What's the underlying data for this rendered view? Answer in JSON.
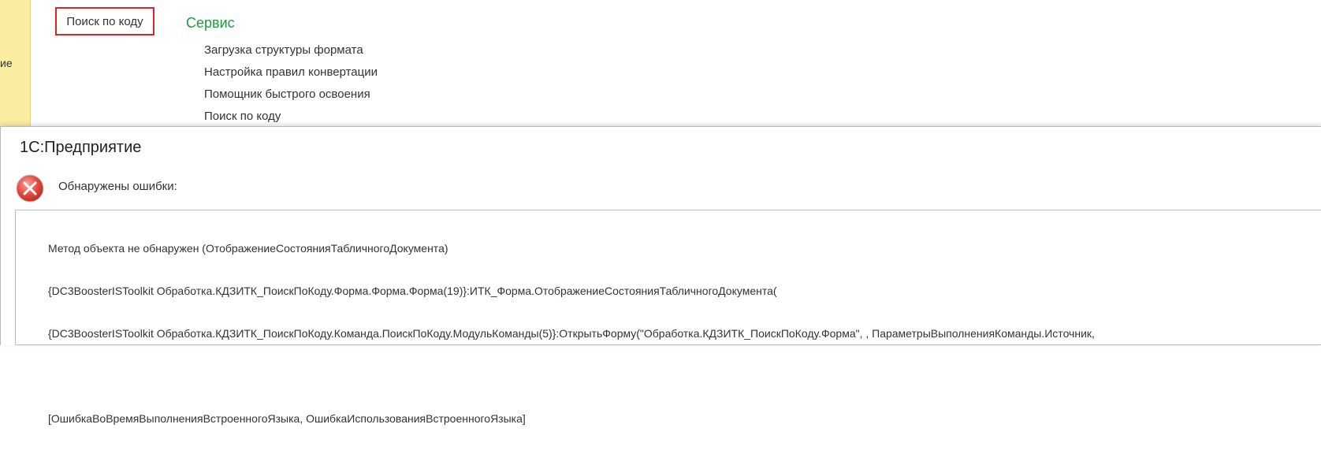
{
  "sidebar": {
    "partial_label": "ие"
  },
  "toolbar": {
    "search_button_label": "Поиск по коду"
  },
  "service": {
    "title": "Сервис",
    "items": [
      {
        "label": "Загрузка структуры формата"
      },
      {
        "label": "Настройка правил конвертации"
      },
      {
        "label": "Помощник быстрого освоения"
      },
      {
        "label": "Поиск по коду"
      }
    ]
  },
  "dialog": {
    "title": "1С:Предприятие",
    "heading": "Обнаружены ошибки:",
    "icon": "error-circle-icon",
    "message_lines": [
      "Метод объекта не обнаружен (ОтображениеСостоянияТабличногоДокумента)",
      "{DC3BoosterISToolkit Обработка.КДЗИТК_ПоискПоКоду.Форма.Форма.Форма(19)}:ИТК_Форма.ОтображениеСостоянияТабличногоДокумента(",
      "{DC3BoosterISToolkit Обработка.КДЗИТК_ПоискПоКоду.Команда.ПоискПоКоду.МодульКоманды(5)}:ОткрытьФорму(\"Обработка.КДЗИТК_ПоискПоКоду.Форма\", , ПараметрыВыполненияКоманды.Источник,",
      "",
      "[ОшибкаВоВремяВыполненияВстроенногоЯзыка, ОшибкаИспользованияВстроенногоЯзыка]"
    ]
  },
  "colors": {
    "sidebar_bg": "#fbeda0",
    "section_title": "#1a9c3c",
    "highlight_border": "#d9262b",
    "error_icon": "#e0453a"
  }
}
